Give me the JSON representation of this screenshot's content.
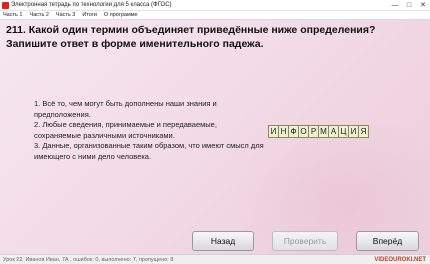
{
  "window": {
    "title": "Электронная тетрадь по технологии для 5 класса (ФГОС)",
    "minimize": "—",
    "maximize": "□",
    "close": "✕"
  },
  "menu": [
    "Часть 1",
    "Часть 2",
    "Часть 3",
    "Итоги",
    "О программе"
  ],
  "question": "211. Какой один термин объединяет приведённые ниже определения? Запишите ответ в форме именительного падежа.",
  "definitions": [
    "1. Всё то, чем могут быть дополнены наши знания и предположения.",
    "2. Любые сведения, принимаемые и передаваемые, сохраняемые различными источниками.",
    "3. Данные, организованные таким образом, что имеют смысл для имеющего с ними дело человека."
  ],
  "answer_letters": [
    "И",
    "Н",
    "Ф",
    "О",
    "Р",
    "М",
    "А",
    "Ц",
    "И",
    "Я"
  ],
  "buttons": {
    "back": "Назад",
    "check": "Проверить",
    "next": "Вперёд"
  },
  "status": "Урок 22. Иванов Иван, 7А , ошибок: 0, выполнено: 7, пропущено: 8",
  "brand": "VIDEOUROKI.NET"
}
